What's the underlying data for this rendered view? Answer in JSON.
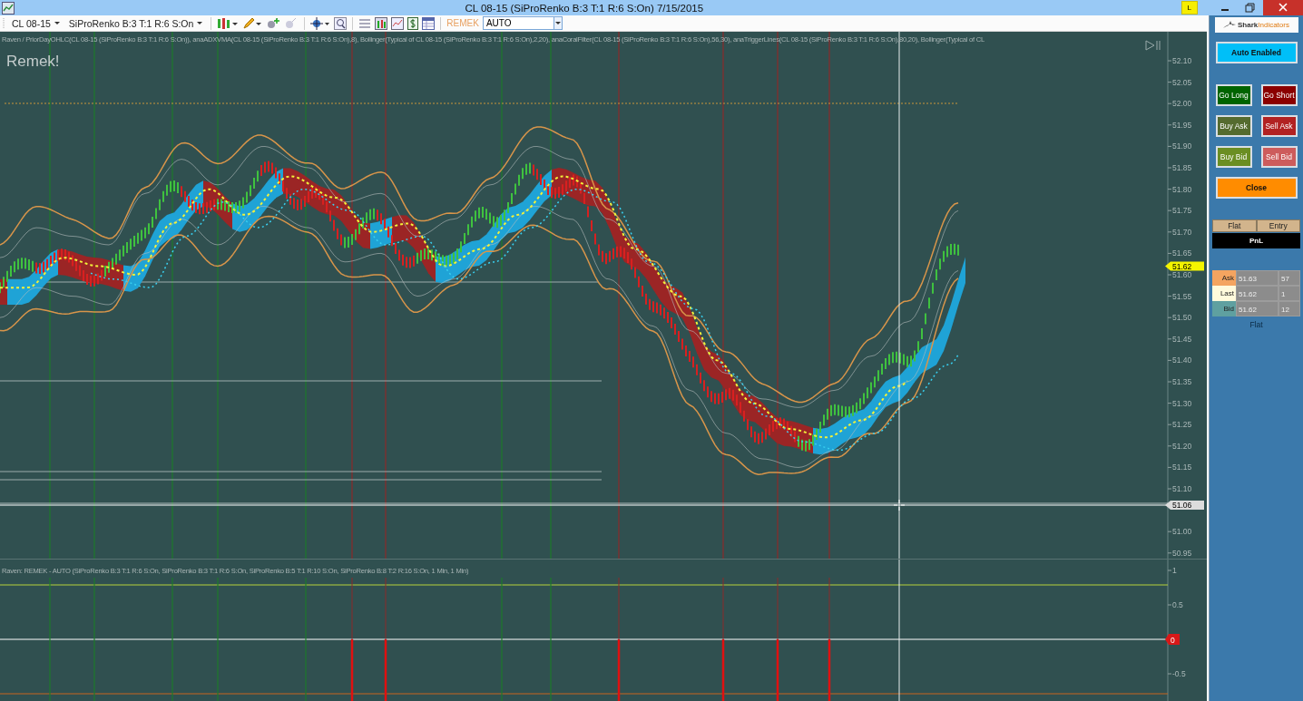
{
  "window": {
    "title": "CL 08-15 (SiProRenko B:3 T:1 R:6 S:On)  7/15/2015",
    "badge": "L"
  },
  "toolbar": {
    "instrument": "CL 08-15",
    "bar_type": "SiProRenko B:3 T:1 R:6 S:On",
    "strategy_label": "REMEK",
    "mode_select": {
      "value": "AUTO"
    }
  },
  "chart": {
    "indicators_label": "Raven / PriorDayOHLC(CL 08-15 (SiProRenko B:3 T:1 R:6 S:On)), anaADXVMA(CL 08-15 (SiProRenko B:3 T:1 R:6 S:On),8), Bollinger(Typical of CL 08-15 (SiProRenko B:3 T:1 R:6 S:On),2,20), anaCoralFilter(CL 08-15 (SiProRenko B:3 T:1 R:6 S:On),56,30), anaTriggerLines(CL 08-15 (SiProRenko B:3 T:1 R:6 S:On),80,20), Bollinger(Typical of CL",
    "chart_label": "Remek!",
    "price_axis": [
      "52.10",
      "52.05",
      "52.00",
      "51.95",
      "51.90",
      "51.85",
      "51.80",
      "51.75",
      "51.70",
      "51.65",
      "51.60",
      "51.55",
      "51.50",
      "51.45",
      "51.40",
      "51.35",
      "51.30",
      "51.25",
      "51.20",
      "51.15",
      "51.10",
      "51.00",
      "50.95"
    ],
    "price_markers": [
      {
        "text": "51.62",
        "kind": "last"
      },
      {
        "text": "51.06",
        "kind": "cursor"
      }
    ]
  },
  "lower_panel": {
    "label": "Raven: REMEK - AUTO (SiProRenko B:3 T:1 R:6 S:On, SiProRenko B:3 T:1 R:6 S:On, SiProRenko B:5 T:1 R:10 S:On, SiProRenko B:8 T:2 R:16 S:On, 1 Min, 1 Min)",
    "axis": [
      "1",
      "0.5",
      "-0.5"
    ],
    "marker": "0"
  },
  "side_panel": {
    "logo": "**Shark**Indicators",
    "buttons": [
      {
        "label": "Auto Enabled",
        "kind": "auto"
      },
      {
        "label": "Go Long",
        "kind": "go-long"
      },
      {
        "label": "Go Short",
        "kind": "go-short"
      },
      {
        "label": "Buy Ask",
        "kind": "buy-ask"
      },
      {
        "label": "Sell Ask",
        "kind": "sell-ask"
      },
      {
        "label": "Buy Bid",
        "kind": "buy-bid"
      },
      {
        "label": "Sell Bid",
        "kind": "sell-bid"
      },
      {
        "label": "Close",
        "kind": "close"
      }
    ],
    "position": {
      "columns": [
        "Flat",
        "Entry"
      ],
      "pnl": "PnL"
    },
    "quotes": [
      {
        "label": "Ask",
        "price": "51.63",
        "size": "57",
        "kind": "ask"
      },
      {
        "label": "Last",
        "price": "51.62",
        "size": "1",
        "kind": "last"
      },
      {
        "label": "Bid",
        "price": "51.62",
        "size": "12",
        "kind": "bid"
      }
    ],
    "status": "Flat"
  }
}
